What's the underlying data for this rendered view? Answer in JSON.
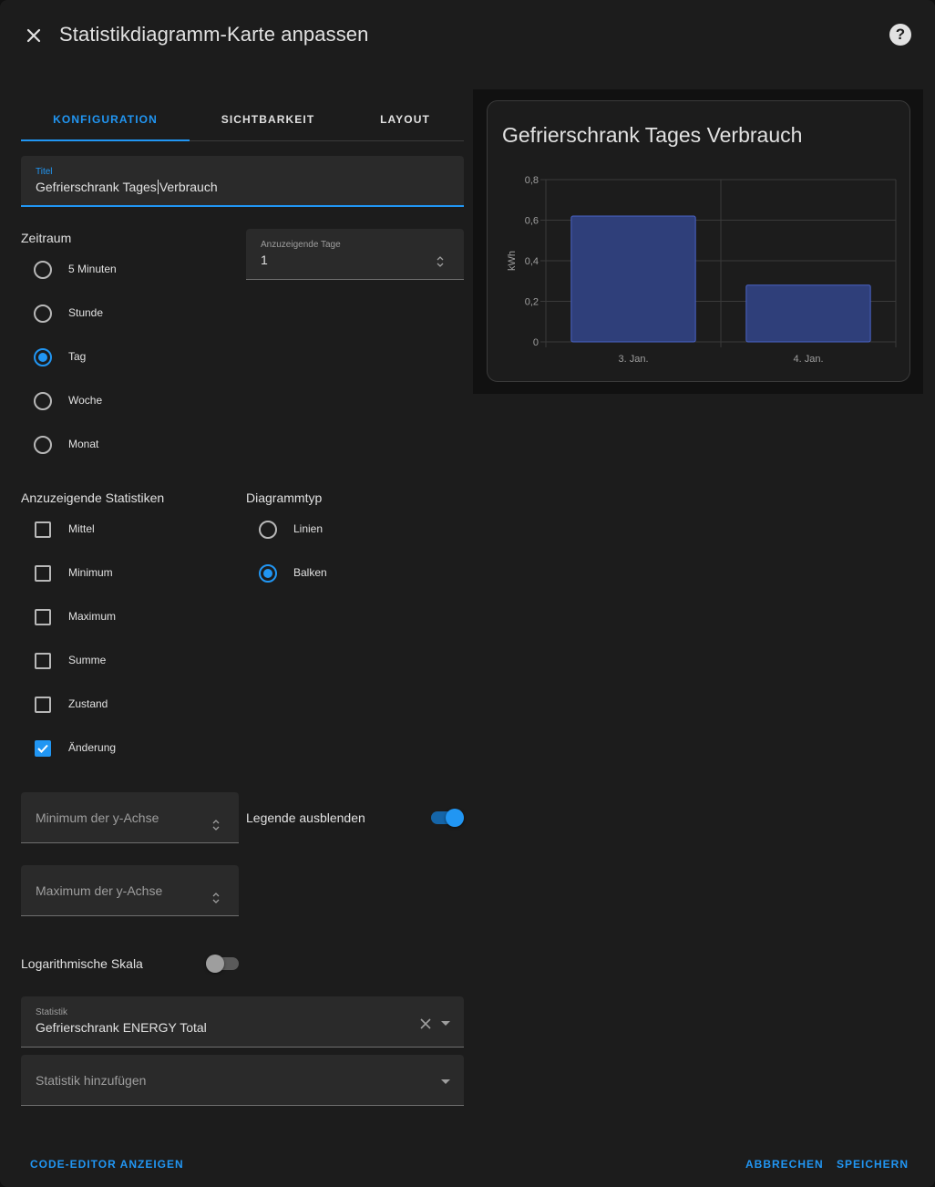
{
  "header": {
    "title": "Statistikdiagramm-Karte anpassen",
    "help": "?"
  },
  "tabs": [
    {
      "label": "KONFIGURATION",
      "active": true
    },
    {
      "label": "SICHTBARKEIT",
      "active": false
    },
    {
      "label": "LAYOUT",
      "active": false
    }
  ],
  "title_field": {
    "label": "Titel",
    "value_before_cursor": "Gefrierschrank Tages",
    "value_after_cursor": "Verbrauch"
  },
  "period": {
    "label": "Zeitraum",
    "options": [
      {
        "label": "5 Minuten",
        "selected": false
      },
      {
        "label": "Stunde",
        "selected": false
      },
      {
        "label": "Tag",
        "selected": true
      },
      {
        "label": "Woche",
        "selected": false
      },
      {
        "label": "Monat",
        "selected": false
      }
    ]
  },
  "days_field": {
    "label": "Anzuzeigende Tage",
    "value": "1"
  },
  "stat_types": {
    "label": "Anzuzeigende Statistiken",
    "options": [
      {
        "label": "Mittel",
        "checked": false
      },
      {
        "label": "Minimum",
        "checked": false
      },
      {
        "label": "Maximum",
        "checked": false
      },
      {
        "label": "Summe",
        "checked": false
      },
      {
        "label": "Zustand",
        "checked": false
      },
      {
        "label": "Änderung",
        "checked": true
      }
    ]
  },
  "chart_type": {
    "label": "Diagrammtyp",
    "options": [
      {
        "label": "Linien",
        "selected": false
      },
      {
        "label": "Balken",
        "selected": true
      }
    ]
  },
  "y_min": {
    "placeholder": "Minimum der y-Achse"
  },
  "y_max": {
    "placeholder": "Maximum der y-Achse"
  },
  "hide_legend": {
    "label": "Legende ausblenden",
    "on": true
  },
  "log_scale": {
    "label": "Logarithmische Skala",
    "on": false
  },
  "statistic": {
    "label": "Statistik",
    "value": "Gefrierschrank ENERGY Total"
  },
  "add_statistic": {
    "placeholder": "Statistik hinzufügen"
  },
  "footer": {
    "code_editor": "CODE-EDITOR ANZEIGEN",
    "cancel": "ABBRECHEN",
    "save": "SPEICHERN"
  },
  "colors": {
    "accent": "#2196f3",
    "bar_fill": "#2f3f7a",
    "bar_stroke": "#4a63c6"
  },
  "preview_card": {
    "title": "Gefrierschrank Tages Verbrauch"
  },
  "chart_data": {
    "type": "bar",
    "categories": [
      "3. Jan.",
      "4. Jan."
    ],
    "values": [
      0.62,
      0.28
    ],
    "yticks": [
      "0",
      "0,2",
      "0,4",
      "0,6",
      "0,8"
    ],
    "ylabel": "kWh",
    "ylim": [
      0,
      0.8
    ],
    "grid": true
  }
}
